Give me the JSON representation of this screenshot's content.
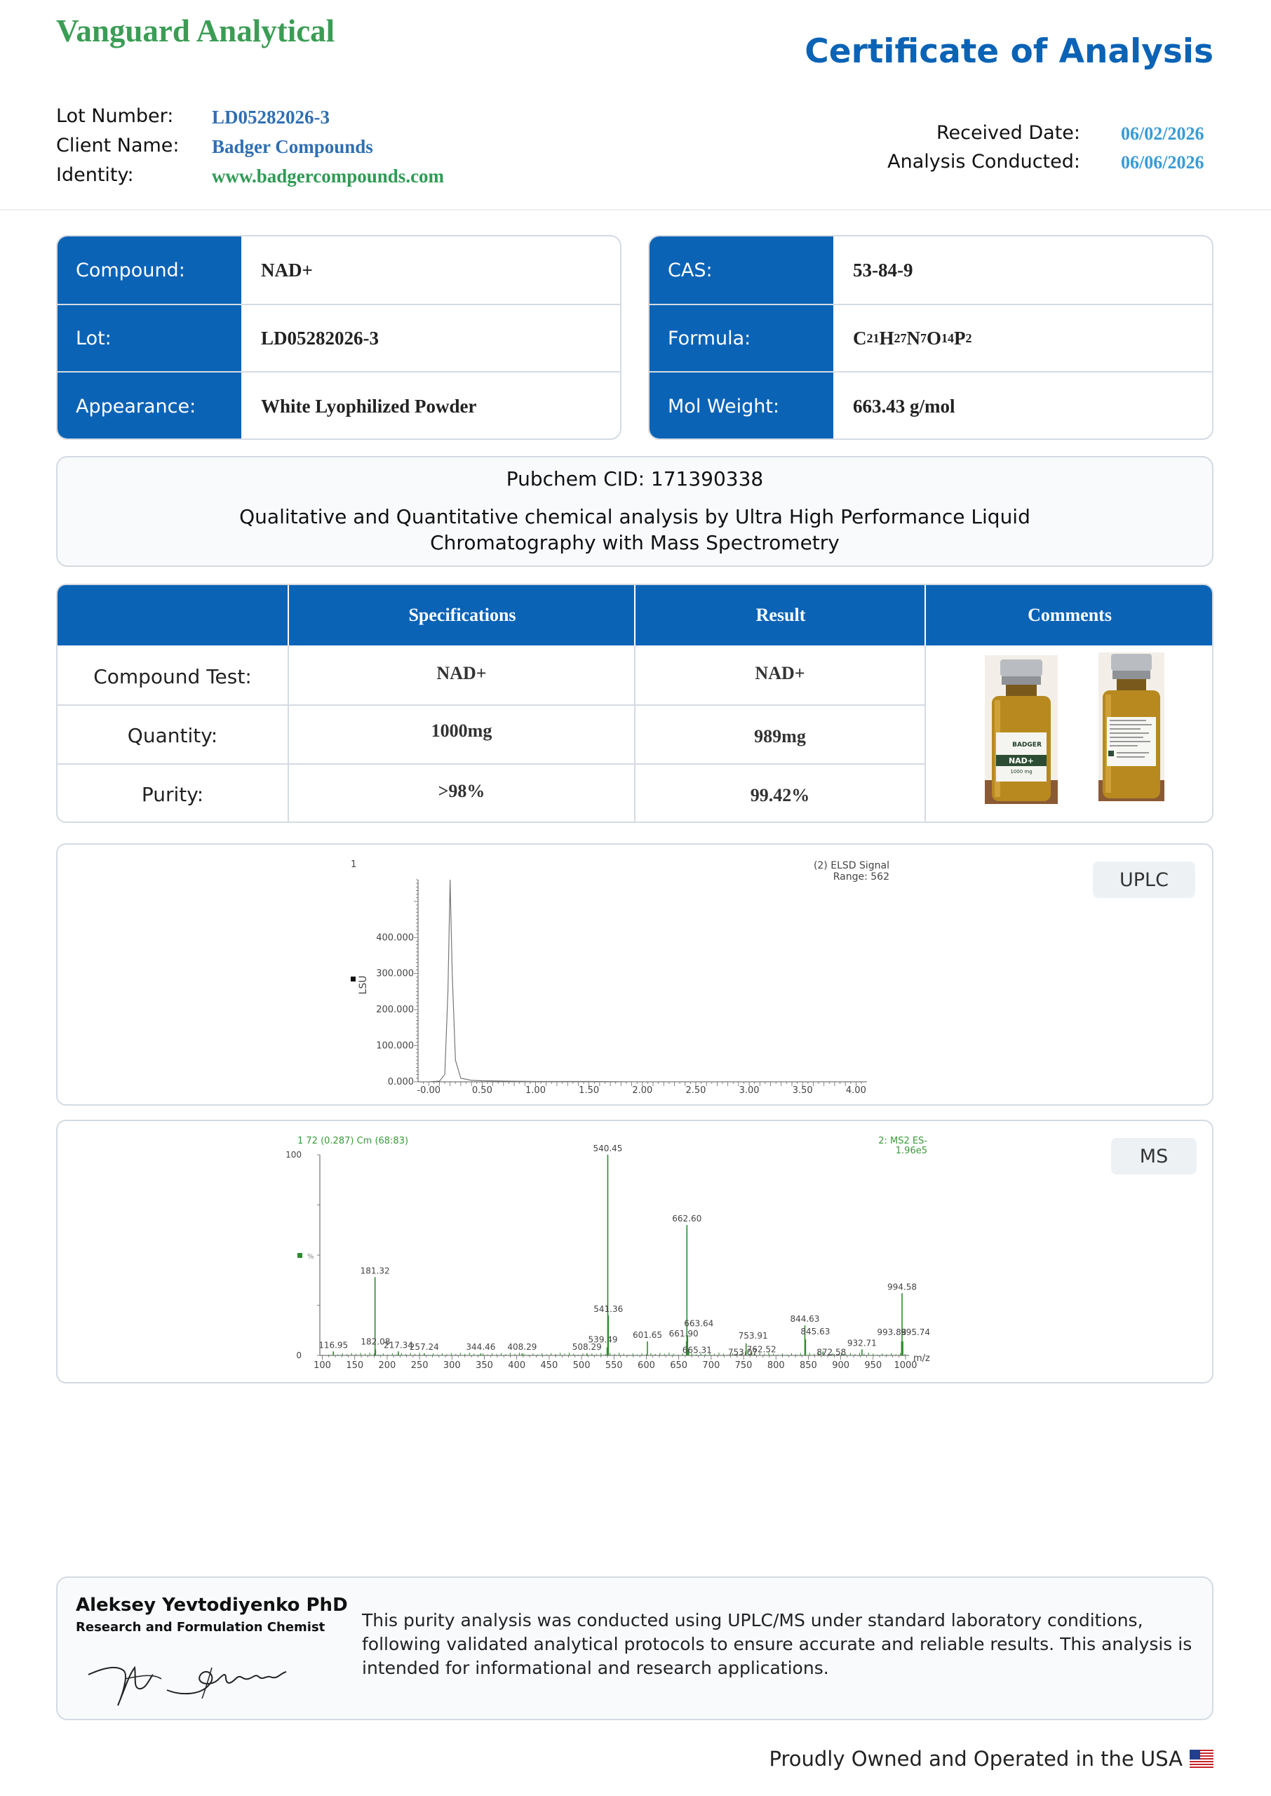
{
  "header": {
    "brand": "Vanguard Analytical",
    "title": "Certificate of Analysis",
    "lot_number_label": "Lot Number:",
    "lot_number": "LD05282026-3",
    "client_name_label": "Client Name:",
    "client_name": "Badger Compounds",
    "identity_label": "Identity:",
    "identity": "www.badgercompounds.com",
    "received_date_label": "Received Date:",
    "received_date": "06/02/2026",
    "analysis_conducted_label": "Analysis Conducted:",
    "analysis_conducted": "06/06/2026"
  },
  "compound_card": {
    "rows": [
      {
        "key": "Compound:",
        "value": "NAD+"
      },
      {
        "key": "Lot:",
        "value": "LD05282026-3"
      },
      {
        "key": "Appearance:",
        "value": "White Lyophilized Powder"
      }
    ]
  },
  "chem_card": {
    "cas_label": "CAS:",
    "cas": "53-84-9",
    "formula_label": "Formula:",
    "formula": "C21H27N7O14P2",
    "mol_weight_label": "Mol Weight:",
    "mol_weight": "663.43 g/mol"
  },
  "pubchem": {
    "cid": "Pubchem CID: 171390338",
    "method_line1": "Qualitative and Quantitative chemical analysis by Ultra High Performance Liquid",
    "method_line2": "Chromatography with Mass Spectrometry"
  },
  "spec_table": {
    "headers": [
      "Specifications",
      "Result",
      "Comments"
    ],
    "rows": [
      {
        "label": "Compound Test:",
        "spec": "NAD+",
        "result": "NAD+"
      },
      {
        "label": "Quantity:",
        "spec": "1000mg",
        "result": "989mg"
      },
      {
        "label": "Purity:",
        "spec": ">98%",
        "result": "99.42%"
      }
    ],
    "vial_label_brand": "BADGER",
    "vial_label_product": "NAD+",
    "vial_label_qty": "1000 mg"
  },
  "uplc": {
    "badge": "UPLC",
    "corner_label": "1",
    "signal_line1": "(2) ELSD Signal",
    "signal_line2": "Range: 562",
    "ylabel": "LSU",
    "xlabel": ""
  },
  "ms": {
    "badge": "MS",
    "scan_label": "1 72 (0.287) Cm (68:83)",
    "mode_line1": "2: MS2 ES-",
    "mode_line2": "1.96e5",
    "y_top": "100",
    "y_bottom": "0",
    "y_mid": "%",
    "xlabel": "m/z"
  },
  "chart_data": [
    {
      "type": "line",
      "title": "",
      "series": [
        {
          "x": [
            -0.05,
            0.0,
            0.1,
            0.15,
            0.18,
            0.2,
            0.22,
            0.25,
            0.3,
            0.4,
            0.5,
            0.7,
            1.0,
            1.5,
            2.0,
            2.5,
            3.0,
            3.5,
            4.0
          ],
          "values": [
            0,
            0,
            2,
            20,
            250,
            560,
            300,
            60,
            10,
            4,
            3,
            2,
            1,
            1,
            0,
            0,
            0,
            0,
            0
          ]
        }
      ],
      "xlabel": "",
      "ylabel": "LSU",
      "x_ticks": [
        "-0.00",
        "0.50",
        "1.00",
        "1.50",
        "2.00",
        "2.50",
        "3.00",
        "3.50",
        "4.00"
      ],
      "y_ticks": [
        "0.000",
        "100.000",
        "200.000",
        "300.000",
        "400.000"
      ],
      "xlim": [
        -0.1,
        4.05
      ],
      "ylim": [
        0,
        560
      ]
    },
    {
      "type": "bar",
      "title": "",
      "xlabel": "m/z",
      "ylabel": "%",
      "xlim": [
        100,
        1000
      ],
      "ylim": [
        0,
        100
      ],
      "x_ticks": [
        "100",
        "150",
        "200",
        "250",
        "300",
        "350",
        "400",
        "450",
        "500",
        "550",
        "600",
        "650",
        "700",
        "750",
        "800",
        "850",
        "900",
        "950",
        "1000"
      ],
      "peaks": [
        {
          "mz": 116.95,
          "rel": 2,
          "label": "116.95"
        },
        {
          "mz": 181.32,
          "rel": 39,
          "label": "181.32"
        },
        {
          "mz": 182.08,
          "rel": 3,
          "label": "182.08"
        },
        {
          "mz": 217.34,
          "rel": 2,
          "label": "217.34"
        },
        {
          "mz": 257.24,
          "rel": 1,
          "label": "257.24"
        },
        {
          "mz": 344.46,
          "rel": 1,
          "label": "344.46"
        },
        {
          "mz": 408.29,
          "rel": 1,
          "label": "408.29"
        },
        {
          "mz": 508.29,
          "rel": 1,
          "label": "508.29"
        },
        {
          "mz": 539.49,
          "rel": 4,
          "label": "539.49"
        },
        {
          "mz": 540.45,
          "rel": 100,
          "label": "540.45"
        },
        {
          "mz": 541.36,
          "rel": 20,
          "label": "541.36"
        },
        {
          "mz": 601.65,
          "rel": 7,
          "label": "601.65"
        },
        {
          "mz": 661.9,
          "rel": 7,
          "label": "661.90"
        },
        {
          "mz": 662.6,
          "rel": 65,
          "label": "662.60"
        },
        {
          "mz": 663.64,
          "rel": 10,
          "label": "663.64"
        },
        {
          "mz": 665.31,
          "rel": 3,
          "label": "665.31"
        },
        {
          "mz": 753.07,
          "rel": 2,
          "label": "753.07"
        },
        {
          "mz": 753.91,
          "rel": 6,
          "label": "753.91"
        },
        {
          "mz": 762.52,
          "rel": 2,
          "label": "762.52"
        },
        {
          "mz": 844.63,
          "rel": 15,
          "label": "844.63"
        },
        {
          "mz": 845.63,
          "rel": 8,
          "label": "845.63"
        },
        {
          "mz": 872.58,
          "rel": 2,
          "label": "872.58"
        },
        {
          "mz": 932.71,
          "rel": 3,
          "label": "932.71"
        },
        {
          "mz": 993.88,
          "rel": 7,
          "label": "993.88"
        },
        {
          "mz": 994.58,
          "rel": 31,
          "label": "994.58"
        },
        {
          "mz": 995.74,
          "rel": 7,
          "label": "995.74"
        }
      ]
    }
  ],
  "footer": {
    "signer_name": "Aleksey Yevtodiyenko PhD",
    "signer_role": "Research and Formulation Chemist",
    "note": "This purity analysis was conducted using UPLC/MS under standard laboratory conditions, following validated analytical protocols to ensure accurate and reliable results. This analysis is intended for informational and research applications.",
    "tagline": "Proudly Owned and Operated in the USA"
  },
  "colors": {
    "brand_green": "#3b9d55",
    "primary_blue": "#0b63b6",
    "date_blue": "#3a9bd5",
    "chart_green": "#2e8b2e"
  }
}
